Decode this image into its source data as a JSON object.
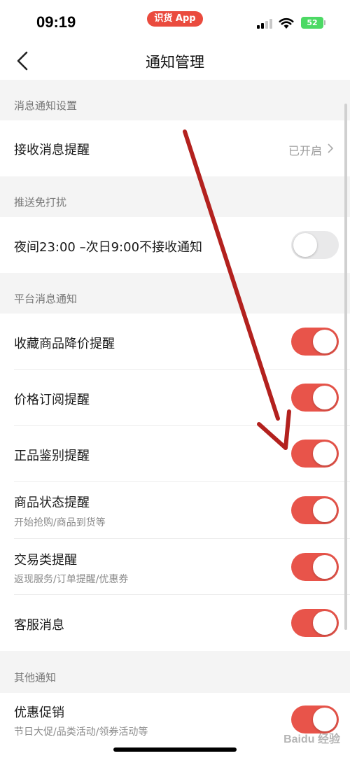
{
  "status_bar": {
    "time": "09:19",
    "app_pill": "识货 App",
    "battery": "52"
  },
  "nav": {
    "title": "通知管理"
  },
  "sections": {
    "message_settings": {
      "header": "消息通知设置"
    },
    "dnd": {
      "header": "推送免打扰"
    },
    "platform": {
      "header": "平台消息通知"
    },
    "other": {
      "header": "其他通知"
    }
  },
  "rows": {
    "receive_reminder": {
      "title": "接收消息提醒",
      "status": "已开启"
    },
    "night_dnd": {
      "title": "夜间23:00 –次日9:00不接收通知",
      "enabled": false
    },
    "favorites_price_drop": {
      "title": "收藏商品降价提醒",
      "enabled": true
    },
    "price_subscription": {
      "title": "价格订阅提醒",
      "enabled": true
    },
    "authenticity": {
      "title": "正品鉴别提醒",
      "enabled": true
    },
    "product_status": {
      "title": "商品状态提醒",
      "subtitle": "开始抢购/商品到货等",
      "enabled": true
    },
    "transactions": {
      "title": "交易类提醒",
      "subtitle": "返现服务/订单提醒/优惠券",
      "enabled": true
    },
    "customer_service": {
      "title": "客服消息",
      "enabled": true
    },
    "promotions": {
      "title": "优惠促销",
      "subtitle": "节日大促/品类活动/领券活动等",
      "enabled": true
    }
  },
  "colors": {
    "accent": "#e8544a",
    "annotation_arrow": "#b3211e"
  },
  "watermark": "Baidu 经验"
}
